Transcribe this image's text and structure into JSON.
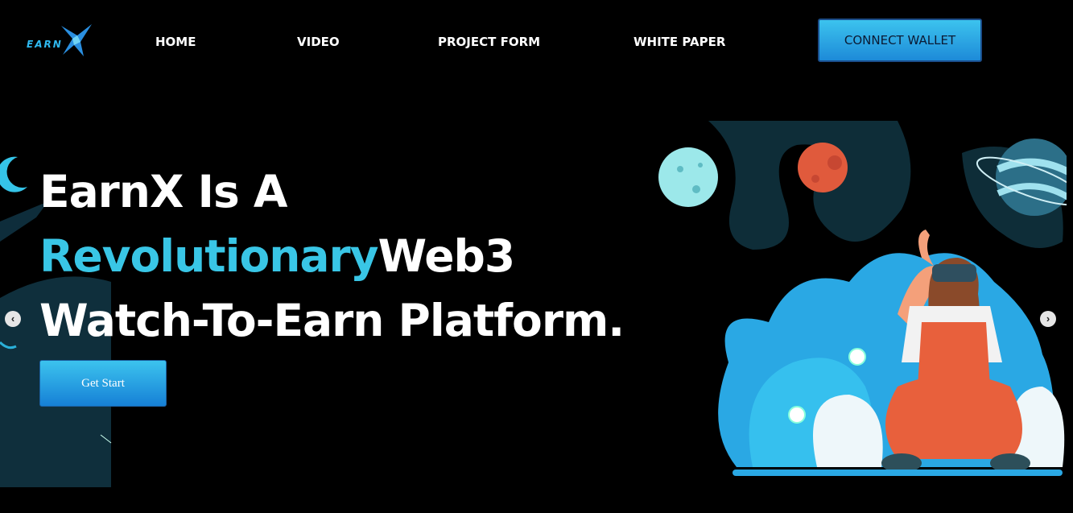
{
  "header": {
    "logo_text": "EARN",
    "nav": [
      {
        "label": "HOME"
      },
      {
        "label": "VIDEO"
      },
      {
        "label": "PROJECT FORM"
      },
      {
        "label": "WHITE PAPER"
      }
    ],
    "connect_label": "CONNECT WALLET"
  },
  "hero": {
    "line1": "EarnX Is A",
    "line2_accent": "Revolutionary",
    "line2_rest": "Web3",
    "line3": "Watch-To-Earn Platform.",
    "cta_label": "Get Start"
  },
  "carousel": {
    "prev_icon": "chevron-left-icon",
    "next_icon": "chevron-right-icon"
  },
  "colors": {
    "accent": "#39c6e6",
    "button": "#1d8ad8",
    "background": "#000000"
  }
}
